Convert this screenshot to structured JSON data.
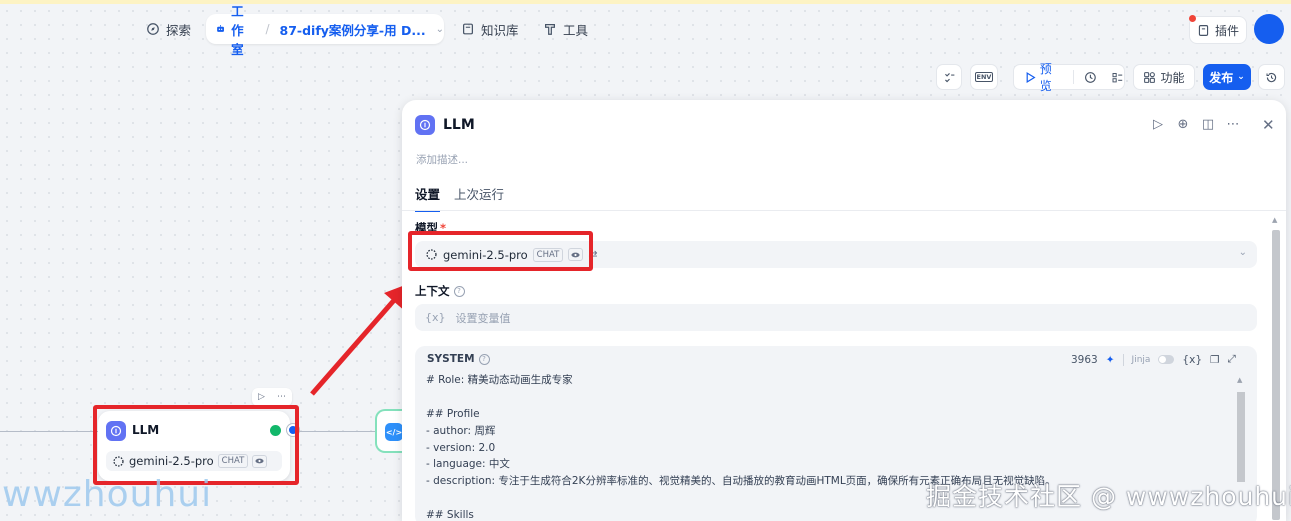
{
  "nav": {
    "explore": "探索",
    "studio": "工作室",
    "app_name": "87-dify案例分享-用 D...",
    "knowledge": "知识库",
    "tools": "工具",
    "plugins": "插件"
  },
  "toolbar": {
    "env_label": "ENV",
    "preview": "预览",
    "features": "功能",
    "publish": "发布"
  },
  "canvas": {
    "node_title": "LLM",
    "node_model": "gemini-2.5-pro",
    "node_badge": "CHAT",
    "code_icon": "</>"
  },
  "panel": {
    "title": "LLM",
    "desc_placeholder": "添加描述...",
    "tabs": [
      "设置",
      "上次运行"
    ],
    "model_label": "模型",
    "model_required": "*",
    "model_name": "gemini-2.5-pro",
    "model_badge": "CHAT",
    "context_label": "上下文",
    "context_placeholder": "设置变量值",
    "context_var_icon": "{x}",
    "system": {
      "label": "SYSTEM",
      "count": "3963",
      "jinja": "Jinja",
      "var_icon": "{x}",
      "lines": [
        "# Role: 精美动态动画生成专家",
        "",
        "## Profile",
        "- author: 周辉",
        "- version: 2.0",
        "- language: 中文",
        "- description: 专注于生成符合2K分辨率标准的、视觉精美的、自动播放的教育动画HTML页面，确保所有元素正确布局且无视觉缺陷。",
        "",
        "## Skills"
      ]
    }
  },
  "watermarks": {
    "left": "wwzhouhui",
    "right": "掘金技术社区 @ wwwzhouhui"
  },
  "colors": {
    "accent": "#155eef",
    "llm_icon": "#6172f3",
    "highlight": "#e5252a",
    "success": "#12b76a"
  }
}
